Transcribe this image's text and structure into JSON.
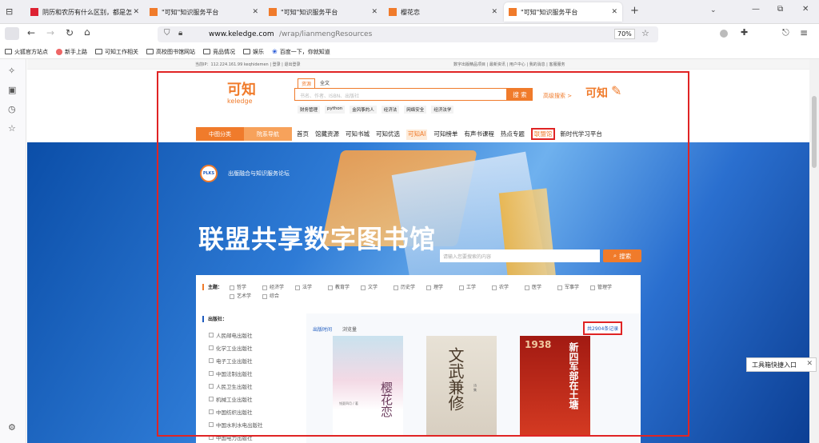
{
  "tabs": [
    {
      "title": "阴历和农历有什么区别，都是怎"
    },
    {
      "title": "\"可知\"知识服务平台"
    },
    {
      "title": "\"可知\"知识服务平台"
    },
    {
      "title": "樱花恋"
    },
    {
      "title": "\"可知\"知识服务平台"
    }
  ],
  "toolbar": {
    "url_host": "www.keledge.com",
    "url_path": "/wrap/lianmengResources",
    "zoom": "70%"
  },
  "bookmarks": [
    "火狐官方站点",
    "新手上路",
    "可知工作相关",
    "高校图书馆网站",
    "竞品情况",
    "娱乐",
    "百度一下，你就知道"
  ],
  "site": {
    "topbar": "当前IP：112.224.161.99 keqhidemen | 登录 | 退出登录",
    "topbar_right": "数字出版精品项目 | 最新资讯 | 用户中心 | 我的消息 | 客服服务",
    "logo_cn": "可知",
    "logo_en": "keledge",
    "search_tabs": [
      "资源",
      "全文"
    ],
    "search_placeholder": "书名、作者、ISBN、出版社",
    "search_btn": "搜 索",
    "adv_search": "高级搜索 >",
    "logo2_cn": "可知",
    "hot_tags": [
      "财务管理",
      "python",
      "金风筝的人",
      "经济法",
      "网络安全",
      "经济法学"
    ],
    "cat_btn": "中图分类",
    "nav_btn": "院系导航",
    "nav": [
      "首页",
      "馆藏资源",
      "可知书城",
      "可知优选",
      "可知AI",
      "可知榜单",
      "有声书课程",
      "热点专题",
      "联盟馆",
      "新时代学习平台"
    ]
  },
  "hero": {
    "badge": "PLKS",
    "forum": "出版融合与知识服务论坛",
    "title": "联盟共享数字图书馆",
    "search_placeholder": "请输入您要搜索的内容",
    "search_btn": "搜索"
  },
  "subjects": {
    "label": "主题：",
    "items": [
      "哲学",
      "经济学",
      "法学",
      "教育学",
      "文学",
      "历史学",
      "理学",
      "工学",
      "农学",
      "医学",
      "军事学",
      "管理学",
      "艺术学",
      "综合"
    ]
  },
  "publishers": {
    "label": "出版社：",
    "items": [
      "人民邮电出版社",
      "化学工业出版社",
      "电子工业出版社",
      "中国法制出版社",
      "人民卫生出版社",
      "机械工业出版社",
      "中国纺织出版社",
      "中国水利水电出版社",
      "中国电力出版社"
    ]
  },
  "sort": [
    "出版时间",
    "浏览量"
  ],
  "count": "共2904条记录",
  "books": [
    {
      "title": "樱花恋",
      "subtitle": "钱夏四月 / 著"
    },
    {
      "title": "文武兼修",
      "subtitle": "诗 集"
    },
    {
      "title": "新四军部在土塘",
      "year": "1938"
    }
  ],
  "tooltip": "工具箱快捷入口"
}
